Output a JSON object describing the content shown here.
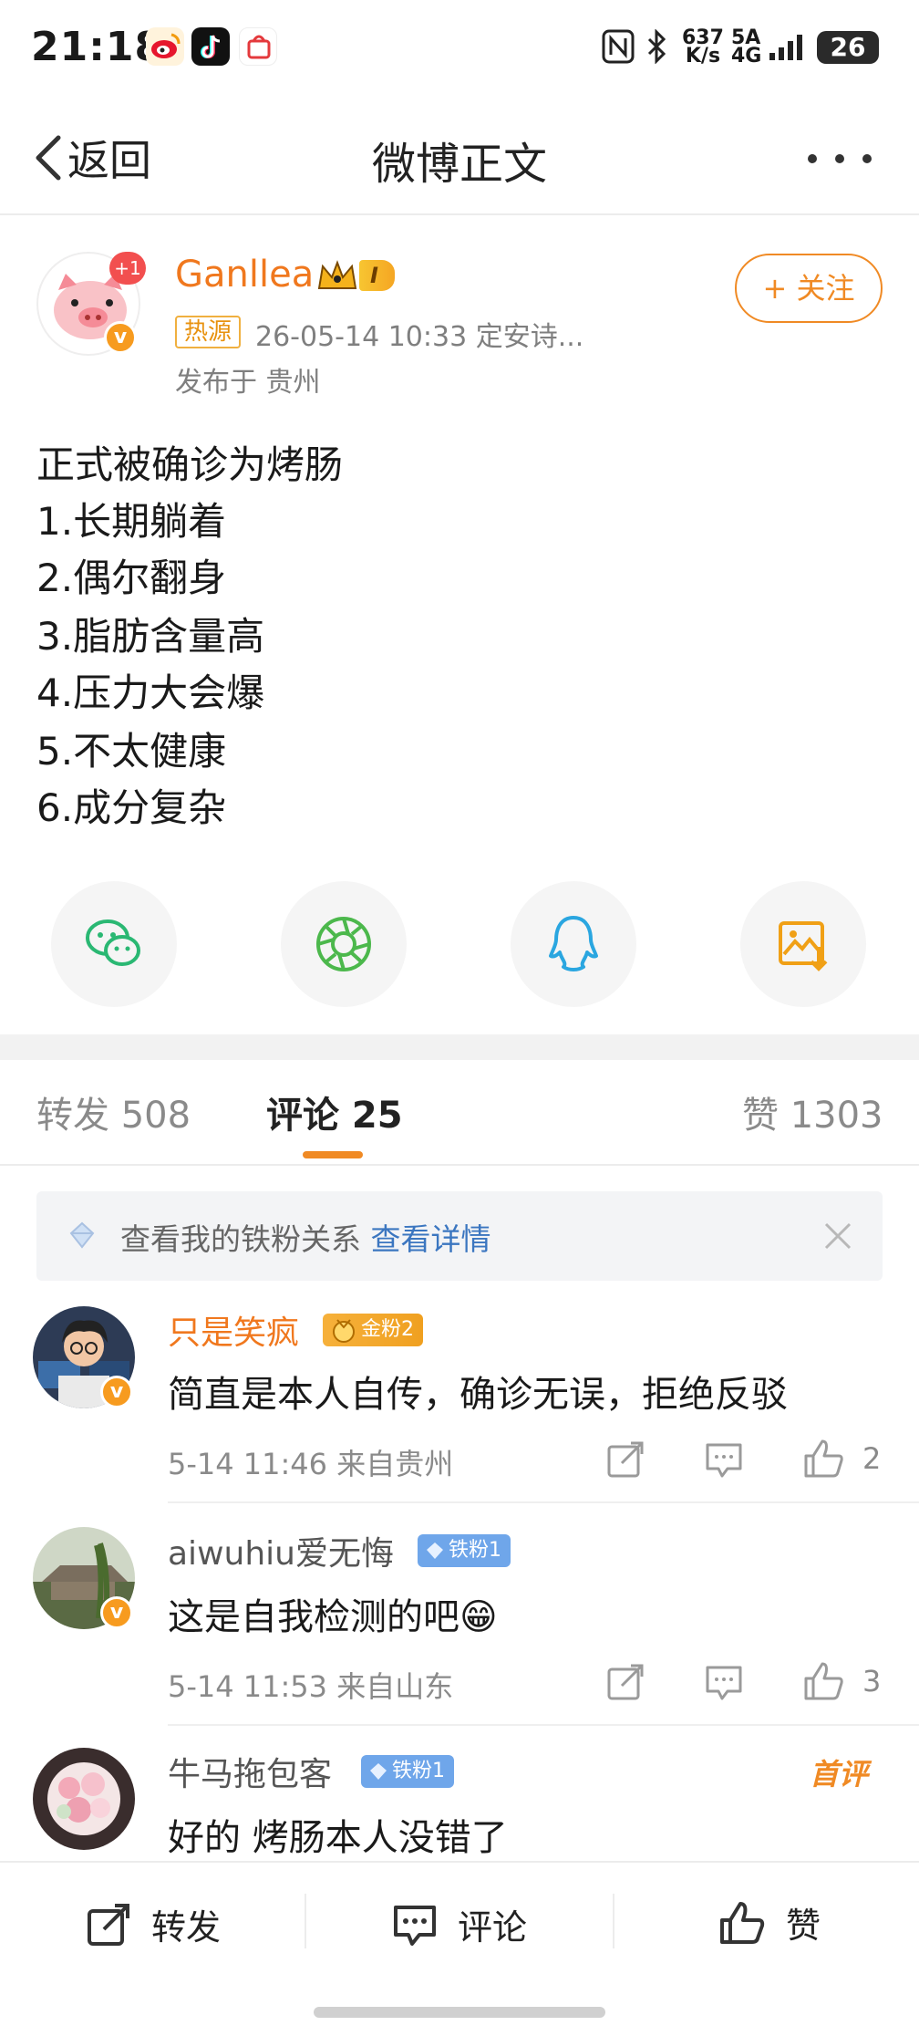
{
  "status_bar": {
    "time": "21:18",
    "net_speed_top": "637",
    "net_speed_bottom": "K/s",
    "signal_top": "5A",
    "signal_bottom": "4G",
    "battery": "26"
  },
  "nav": {
    "back_label": "返回",
    "title": "微博正文"
  },
  "author": {
    "name": "Ganllea",
    "plus_badge": "+1",
    "level_badge": "I",
    "hot_tag": "热源",
    "timestamp_source": "26-05-14 10:33  定安诗...",
    "location": "发布于 贵州",
    "follow_label": "+ 关注"
  },
  "post": {
    "lines": [
      "正式被确诊为烤肠",
      "1.长期躺着",
      "2.偶尔翻身",
      "3.脂肪含量高",
      "4.压力大会爆",
      "5.不太健康",
      "6.成分复杂"
    ]
  },
  "share": {
    "icons": [
      "wechat-icon",
      "moments-icon",
      "qq-icon",
      "save-image-icon"
    ]
  },
  "tabs": {
    "repost": "转发 508",
    "comment": "评论 25",
    "like": "赞 1303"
  },
  "fan_bar": {
    "text": "查看我的铁粉关系",
    "link": "查看详情"
  },
  "comments": [
    {
      "name": "只是笑疯",
      "badge": "金粉2",
      "text": "简直是本人自传，确诊无误，拒绝反驳",
      "meta": "5-14 11:46 来自贵州",
      "likes": "2"
    },
    {
      "name": "aiwuhiu爱无悔",
      "badge": "铁粉1",
      "text": "这是自我检测的吧😁",
      "meta": "5-14 11:53 来自山东",
      "likes": "3"
    },
    {
      "name": "牛马拖包客",
      "badge": "铁粉1",
      "text": "好的 烤肠本人没错了",
      "first_tag": "首评"
    }
  ],
  "bottom_bar": {
    "repost": "转发",
    "comment": "评论",
    "like": "赞"
  },
  "colors": {
    "accent": "#f08a24",
    "name_orange": "#f0781e",
    "link_blue": "#3b76c0",
    "muted": "#8a8a8a"
  }
}
